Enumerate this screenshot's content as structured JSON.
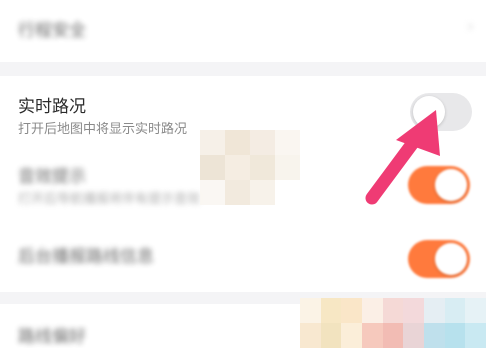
{
  "settings": {
    "trip_safety": {
      "title": "行程安全"
    },
    "realtime_traffic": {
      "title": "实时路况",
      "subtitle": "打开后地图中将显示实时路况",
      "enabled": false
    },
    "voice_prompt": {
      "title": "音效提示",
      "subtitle": "打开后导航播报将伴有提示音效",
      "enabled": true
    },
    "auto_speaker": {
      "title": "后台播报路线信息",
      "enabled": true
    },
    "bottom_item": {
      "title": "路线偏好"
    }
  },
  "colors": {
    "toggle_on": "#ff7a3d",
    "toggle_off": "#e8e8ea",
    "arrow": "#ef3b74"
  }
}
